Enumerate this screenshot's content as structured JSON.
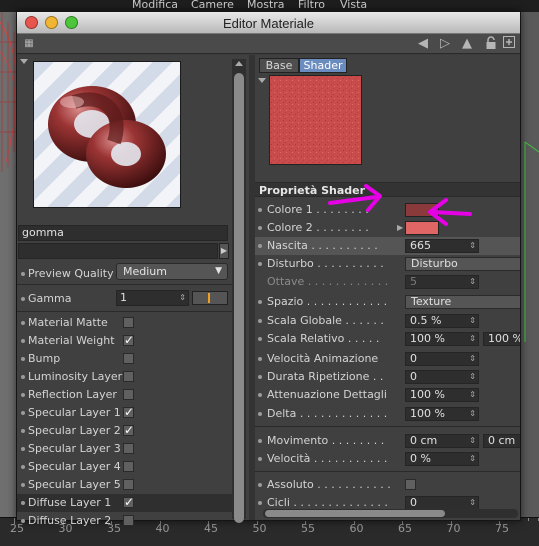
{
  "menubar": {
    "items": [
      "Modifica",
      "Camere",
      "Mostra",
      "Filtro",
      "Vista"
    ]
  },
  "ruler": {
    "labels": [
      "25",
      "30",
      "35",
      "40",
      "45",
      "50",
      "55",
      "60",
      "65",
      "70",
      "75"
    ]
  },
  "window": {
    "title": "Editor Materiale"
  },
  "left": {
    "material_name": "gomma",
    "preview_quality_label": "Preview Quality",
    "preview_quality_value": "Medium",
    "gamma_label": "Gamma",
    "gamma_value": "1",
    "channels": [
      {
        "label": "Material Matte",
        "checked": false
      },
      {
        "label": "Material Weight",
        "checked": true
      },
      {
        "label": "Bump",
        "checked": false
      },
      {
        "label": "Luminosity Layer",
        "checked": false
      },
      {
        "label": "Reflection Layer",
        "checked": false
      },
      {
        "label": "Specular Layer 1",
        "checked": true
      },
      {
        "label": "Specular Layer 2",
        "checked": true
      },
      {
        "label": "Specular Layer 3",
        "checked": false
      },
      {
        "label": "Specular Layer 4",
        "checked": false
      },
      {
        "label": "Specular Layer 5",
        "checked": false
      },
      {
        "label": "Diffuse Layer 1",
        "checked": true,
        "selected": true
      },
      {
        "label": "Diffuse Layer 2",
        "checked": false
      }
    ],
    "checkmark": "✓"
  },
  "right": {
    "tabs": [
      "Base",
      "Shader"
    ],
    "active_tab": "Shader",
    "section_title": "Proprietà Shader",
    "colore1_label": "Colore 1",
    "colore1_color": "#8a3a3a",
    "colore2_label": "Colore 2",
    "colore2_color": "#e06666",
    "nascita_label": "Nascita",
    "nascita_value": "665",
    "disturbo_label": "Disturbo",
    "disturbo_value": "Disturbo",
    "ottave_label": "Ottave",
    "ottave_value": "5",
    "spazio_label": "Spazio",
    "spazio_value": "Texture",
    "scala_globale_label": "Scala Globale",
    "scala_globale_value": "0.5 %",
    "scala_relativo_label": "Scala Relativo",
    "scala_relativo_value1": "100 %",
    "scala_relativo_value2": "100 %",
    "velocita_anim_label": "Velocità Animazione",
    "velocita_anim_value": "0",
    "durata_rip_label": "Durata Ripetizione",
    "durata_rip_value": "0",
    "attenuazione_label": "Attenuazione Dettagli",
    "attenuazione_value": "100 %",
    "delta_label": "Delta",
    "delta_value": "100 %",
    "movimento_label": "Movimento",
    "movimento_value1": "0 cm",
    "movimento_value2": "0 cm",
    "velocita_label": "Velocità",
    "velocita_value": "0 %",
    "assoluto_label": "Assoluto",
    "cicli_label": "Cicli",
    "cicli_value": "0"
  },
  "colors": {
    "annotation": "#e600e6",
    "shader_red": "#c94c4c"
  }
}
